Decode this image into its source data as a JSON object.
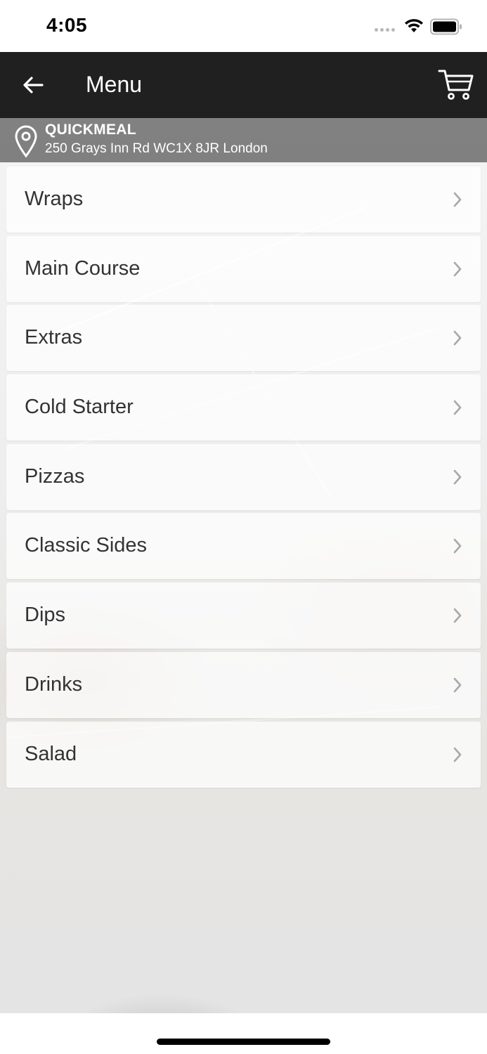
{
  "status_bar": {
    "time": "4:05",
    "wifi_icon": "wifi-icon",
    "battery_icon": "battery-icon"
  },
  "nav": {
    "title": "Menu",
    "back_icon": "arrow-left-icon",
    "cart_icon": "cart-icon",
    "background_color": "#202020"
  },
  "location": {
    "icon": "map-pin-icon",
    "store_name": "QUICKMEAL",
    "address": "250 Grays Inn Rd WC1X 8JR London"
  },
  "menu": {
    "items": [
      {
        "label": "Wraps"
      },
      {
        "label": "Main Course"
      },
      {
        "label": "Extras"
      },
      {
        "label": "Cold Starter"
      },
      {
        "label": "Pizzas"
      },
      {
        "label": "Classic Sides"
      },
      {
        "label": "Dips"
      },
      {
        "label": "Drinks"
      },
      {
        "label": "Salad"
      }
    ],
    "chevron_icon": "chevron-right-icon"
  }
}
